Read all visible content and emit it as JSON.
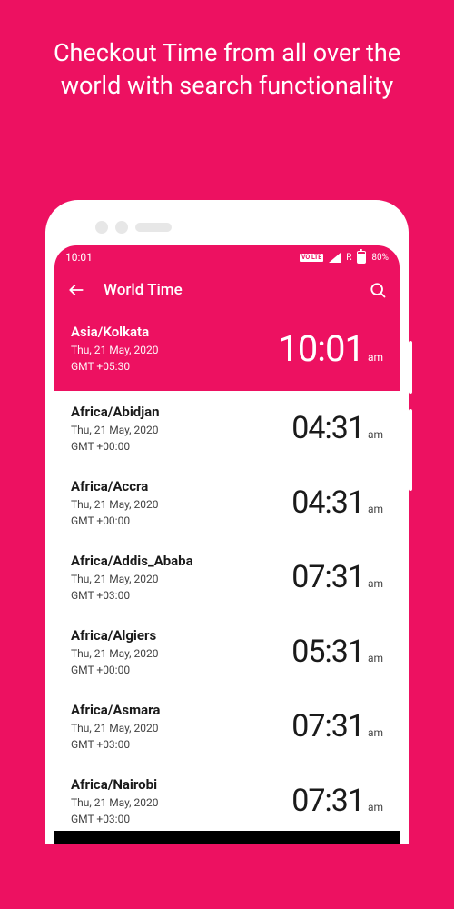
{
  "promo": "Checkout Time from all over the world with search functionality",
  "status": {
    "time": "10:01",
    "volte": "VO LTE",
    "roaming": "R",
    "battery": "80%"
  },
  "appbar": {
    "title": "World Time"
  },
  "hero": {
    "name": "Asia/Kolkata",
    "date": "Thu, 21 May, 2020",
    "gmt": "GMT +05:30",
    "time": "10:01",
    "ampm": "am"
  },
  "rows": [
    {
      "name": "Africa/Abidjan",
      "date": "Thu, 21 May, 2020",
      "gmt": "GMT +00:00",
      "time": "04:31",
      "ampm": "am"
    },
    {
      "name": "Africa/Accra",
      "date": "Thu, 21 May, 2020",
      "gmt": "GMT +00:00",
      "time": "04:31",
      "ampm": "am"
    },
    {
      "name": "Africa/Addis_Ababa",
      "date": "Thu, 21 May, 2020",
      "gmt": "GMT +03:00",
      "time": "07:31",
      "ampm": "am"
    },
    {
      "name": "Africa/Algiers",
      "date": "Thu, 21 May, 2020",
      "gmt": "GMT +00:00",
      "time": "05:31",
      "ampm": "am"
    },
    {
      "name": "Africa/Asmara",
      "date": "Thu, 21 May, 2020",
      "gmt": "GMT +03:00",
      "time": "07:31",
      "ampm": "am"
    },
    {
      "name": "Africa/Nairobi",
      "date": "Thu, 21 May, 2020",
      "gmt": "GMT +03:00",
      "time": "07:31",
      "ampm": "am"
    }
  ]
}
